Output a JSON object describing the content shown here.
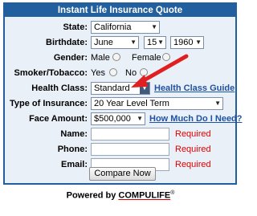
{
  "header": {
    "title": "Instant Life Insurance Quote"
  },
  "fields": {
    "state": {
      "label": "State:",
      "value": "California"
    },
    "birthdate": {
      "label": "Birthdate:",
      "month": "June",
      "day": "15",
      "year": "1960"
    },
    "gender": {
      "label": "Gender:",
      "option_male": "Male",
      "option_female": "Female"
    },
    "smoker": {
      "label": "Smoker/Tobacco:",
      "option_yes": "Yes",
      "option_no": "No"
    },
    "health_class": {
      "label": "Health Class:",
      "value": "Standard",
      "guide_link": "Health Class Guide"
    },
    "insurance_type": {
      "label": "Type of Insurance:",
      "value": "20 Year Level Term"
    },
    "face_amount": {
      "label": "Face Amount:",
      "value": "$500,000",
      "help_link": "How Much Do I Need?"
    },
    "name": {
      "label": "Name:",
      "required": "Required"
    },
    "phone": {
      "label": "Phone:",
      "required": "Required"
    },
    "email": {
      "label": "Email:",
      "required": "Required"
    }
  },
  "actions": {
    "submit_label": "Compare Now"
  },
  "footer": {
    "powered_text": "Powered by ",
    "brand": "COMPULIFE",
    "reg_mark": "®"
  },
  "colors": {
    "header_bg": "#215f9e",
    "panel_bg": "#eaf0f8",
    "link": "#1d52a5",
    "required": "#e00000",
    "annotation_arrow": "#e02020"
  }
}
